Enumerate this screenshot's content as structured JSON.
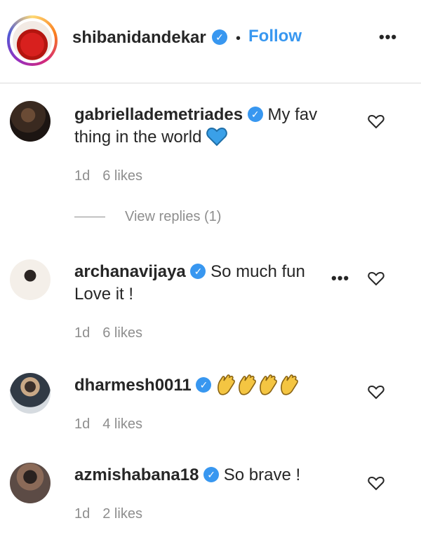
{
  "post_header": {
    "username": "shibanidandekar",
    "separator": "•",
    "follow_label": "Follow",
    "more_label": "•••"
  },
  "comments": [
    {
      "username": "gabrielladEmetriades",
      "text_before": "My fav",
      "text_rest": "thing in the world",
      "emoji": "blue-heart-icon",
      "time": "1d",
      "likes": "6 likes",
      "view_replies": "View replies (1)"
    },
    {
      "username": "archanavijaya",
      "text_before": "So much fun",
      "text_rest": "Love it !",
      "time": "1d",
      "likes": "6 likes",
      "more_label": "•••"
    },
    {
      "username": "dharmesh0011",
      "emoji": "clapping-hands-icon",
      "time": "1d",
      "likes": "4 likes"
    },
    {
      "username": "azmishabana18",
      "text_before": "So brave !",
      "time": "1d",
      "likes": "2 likes"
    }
  ],
  "colors": {
    "accent": "#3897f0",
    "text": "#262626",
    "secondary": "#8e8e8e",
    "divider": "#dbdbdb"
  }
}
